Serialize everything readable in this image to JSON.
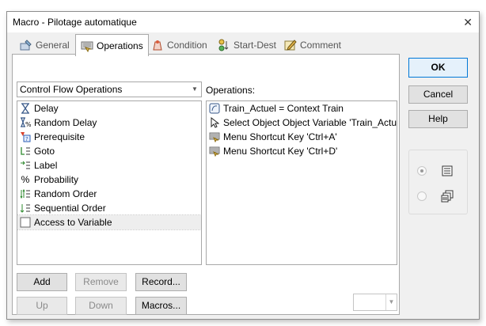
{
  "window": {
    "title": "Macro - Pilotage automatique",
    "close_glyph": "✕"
  },
  "tabs": [
    {
      "label": "General",
      "icon": "general-icon"
    },
    {
      "label": "Operations",
      "icon": "operations-icon"
    },
    {
      "label": "Condition",
      "icon": "condition-icon"
    },
    {
      "label": "Start-Dest",
      "icon": "start-dest-icon"
    },
    {
      "label": "Comment",
      "icon": "comment-icon"
    }
  ],
  "active_tab": "Operations",
  "category_select": {
    "value": "Control Flow Operations"
  },
  "flow_items": [
    {
      "label": "Delay",
      "icon": "hourglass-icon"
    },
    {
      "label": "Random Delay",
      "icon": "random-delay-icon"
    },
    {
      "label": "Prerequisite",
      "icon": "prerequisite-icon"
    },
    {
      "label": "Goto",
      "icon": "goto-icon"
    },
    {
      "label": "Label",
      "icon": "label-icon"
    },
    {
      "label": "Probability",
      "icon": "percent-icon",
      "glyph": "%"
    },
    {
      "label": "Random Order",
      "icon": "random-order-icon"
    },
    {
      "label": "Sequential Order",
      "icon": "sequential-order-icon"
    },
    {
      "label": "Access to Variable",
      "icon": "variable-icon",
      "selected": true
    }
  ],
  "operations_label": "Operations:",
  "operations": [
    {
      "label": "Train_Actuel = Context Train",
      "icon": "context-icon"
    },
    {
      "label": "Select Object Object Variable 'Train_Actuel'",
      "icon": "cursor-icon"
    },
    {
      "label": "Menu Shortcut Key 'Ctrl+A'",
      "icon": "keyboard-icon"
    },
    {
      "label": "Menu Shortcut Key 'Ctrl+D'",
      "icon": "keyboard-icon"
    }
  ],
  "buttons": {
    "add": "Add",
    "remove": "Remove",
    "record": "Record...",
    "up": "Up",
    "down": "Down",
    "macros": "Macros...",
    "ok": "OK",
    "cancel": "Cancel",
    "help": "Help"
  },
  "colors": {
    "accent": "#0078d7",
    "window_bg": "#f0f0f0",
    "disabled_text": "#8a8a8a"
  }
}
